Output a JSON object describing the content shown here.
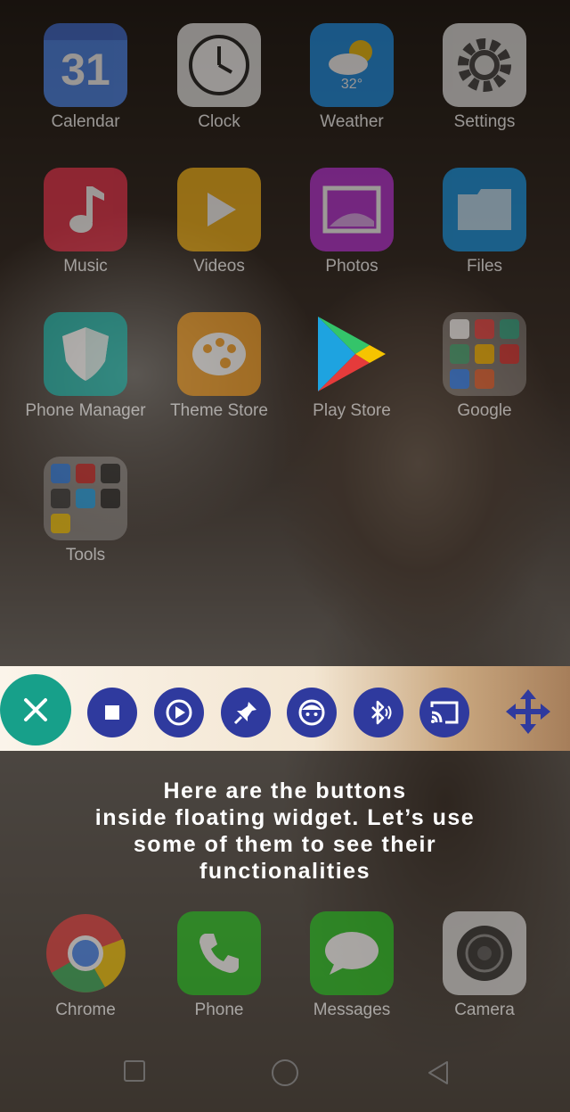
{
  "apps": [
    {
      "label": "Calendar"
    },
    {
      "label": "Clock"
    },
    {
      "label": "Weather"
    },
    {
      "label": "Settings"
    },
    {
      "label": "Music"
    },
    {
      "label": "Videos"
    },
    {
      "label": "Photos"
    },
    {
      "label": "Files"
    },
    {
      "label": "Phone Manager"
    },
    {
      "label": "Theme Store"
    },
    {
      "label": "Play Store"
    },
    {
      "label": "Google"
    },
    {
      "label": "Tools"
    }
  ],
  "calendar_day": "31",
  "weather_temp": "32°",
  "dock": [
    {
      "label": "Chrome"
    },
    {
      "label": "Phone"
    },
    {
      "label": "Messages"
    },
    {
      "label": "Camera"
    }
  ],
  "widget": {
    "buttons": [
      "close-icon",
      "stop-icon",
      "play-icon",
      "pin-icon",
      "face-icon",
      "bluetooth-icon",
      "cast-icon",
      "move-icon"
    ],
    "accent_close": "#17a08a",
    "accent_button": "#2f3a9e"
  },
  "hint_lines": [
    "Here are the buttons",
    "inside floating widget. Let’s use",
    "some of them to see their",
    "functionalities"
  ],
  "nav": [
    "recent-apps-icon",
    "home-icon",
    "back-icon"
  ]
}
